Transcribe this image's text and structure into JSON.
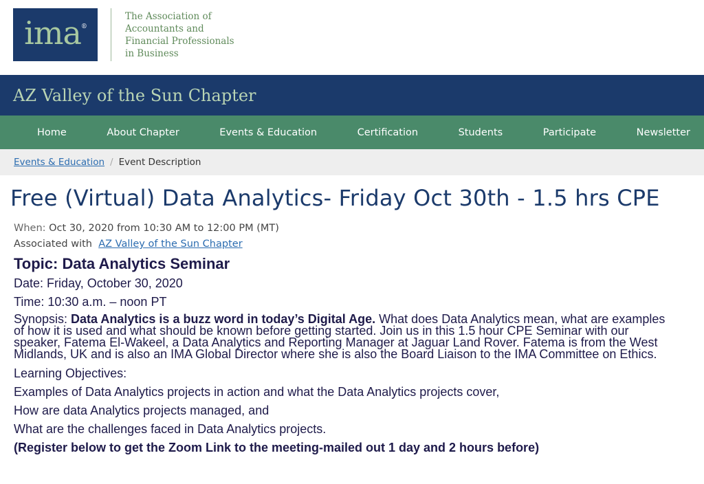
{
  "brand": {
    "logo_text": "ima",
    "logo_mark": "®",
    "assoc_lines": [
      "The Association of",
      "Accountants and",
      "Financial Professionals",
      "in Business"
    ]
  },
  "chapter": {
    "title": "AZ Valley of the Sun Chapter"
  },
  "nav": {
    "items": [
      "Home",
      "About Chapter",
      "Events & Education",
      "Certification",
      "Students",
      "Participate",
      "Newsletter"
    ]
  },
  "breadcrumb": {
    "link": "Events & Education",
    "separator": "/",
    "current": "Event Description"
  },
  "event": {
    "title": "Free (Virtual) Data Analytics- Friday Oct 30th - 1.5 hrs CPE",
    "when_label": "When:",
    "when_value": "Oct 30, 2020 from 10:30 AM to 12:00 PM (MT)",
    "assoc_label": "Associated with",
    "assoc_link": "AZ Valley of the Sun Chapter"
  },
  "content": {
    "topic": "Topic: Data Analytics Seminar",
    "date": "Date: Friday, October 30, 2020",
    "time": "Time: 10:30 a.m. – noon PT",
    "synopsis_label": "Synopsis: ",
    "synopsis_bold": "Data Analytics is a buzz word in today’s Digital Age.",
    "synopsis_rest": " What does Data Analytics mean, what are examples of how it is used and what should be known before getting started. Join us in this 1.5 hour CPE Seminar with our speaker, Fatema El-Wakeel, a Data Analytics and Reporting Manager at Jaguar Land Rover. Fatema is from the West Midlands, UK and is also an IMA Global Director where she is also the Board Liaison to the IMA Committee on Ethics.",
    "objectives_heading": "Learning Objectives:",
    "objectives": [
      "Examples of Data Analytics projects in action and what the Data Analytics projects cover,",
      "How are data Analytics projects managed, and",
      "What are the challenges faced in Data Analytics projects."
    ],
    "register": "(Register below to get the Zoom Link to the meeting-mailed out 1 day and 2 hours before)"
  },
  "colors": {
    "navy": "#1b3a6b",
    "green_nav": "#4a8a6a",
    "sage": "#a8c8a0",
    "link": "#2b6cb0",
    "body_text": "#1e1a4a"
  }
}
